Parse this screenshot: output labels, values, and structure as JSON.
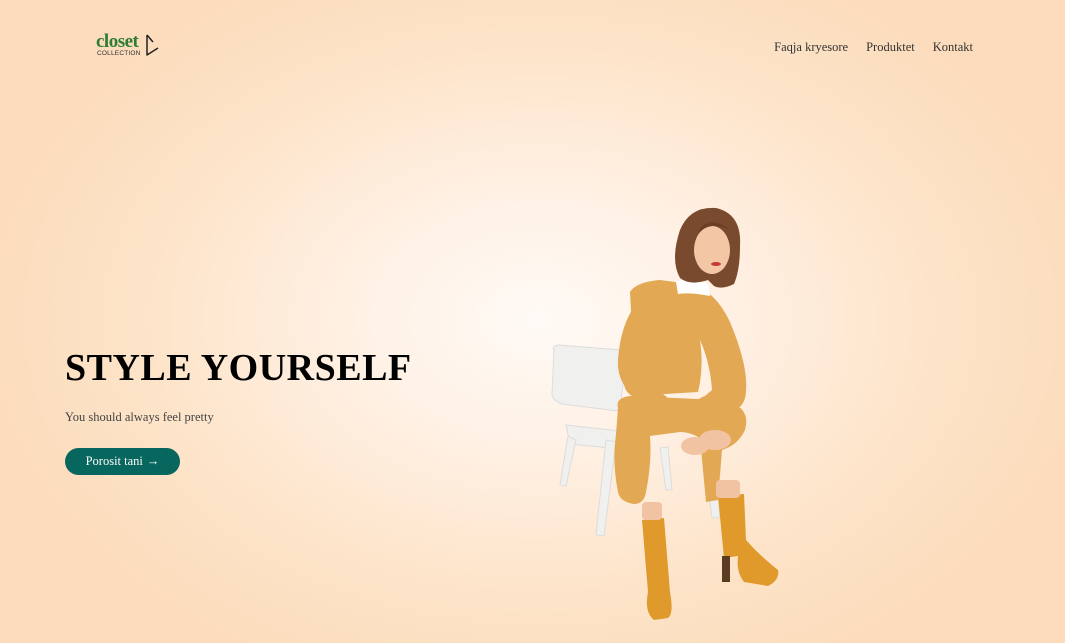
{
  "logo": {
    "word": "closet",
    "sub": "COLLECTION",
    "icon": "hanger-icon"
  },
  "nav": {
    "items": [
      "Faqja kryesore",
      "Produktet",
      "Kontakt"
    ]
  },
  "hero": {
    "title": "STYLE YOURSELF",
    "subtitle": "You should always feel pretty",
    "cta_label": "Porosit tani",
    "cta_arrow": "→"
  },
  "colors": {
    "accent": "#07665e",
    "logo_green": "#2e7d32",
    "outfit": "#e2a853",
    "boots": "#e09a2c"
  }
}
